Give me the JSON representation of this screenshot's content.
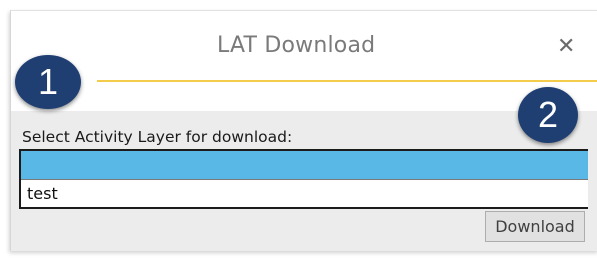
{
  "window": {
    "title": "LAT Download",
    "close_glyph": "✕"
  },
  "annotations": {
    "badge_1": "1",
    "badge_2": "2",
    "badge_color": "#1f3f73"
  },
  "form": {
    "select_label": "Select Activity Layer for download:",
    "options": [
      {
        "label": "",
        "selected": true
      },
      {
        "label": "test",
        "selected": false
      }
    ],
    "download_label": "Download"
  },
  "colors": {
    "accent_line": "#f2cc4a",
    "selection": "#59b8e6"
  }
}
